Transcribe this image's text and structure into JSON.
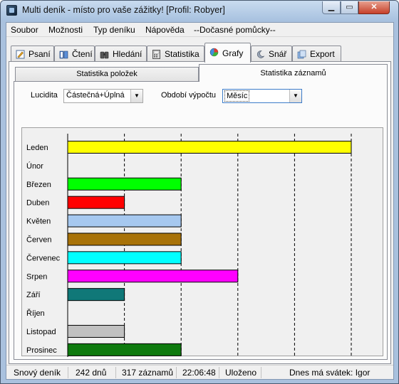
{
  "window": {
    "title": "Multi deník - místo pro vaše zážitky! [Profil: Robyer]"
  },
  "menu": [
    "Soubor",
    "Možnosti",
    "Typ deníku",
    "Nápověda",
    "--Dočasné pomůcky--"
  ],
  "tabs": [
    {
      "label": "Psaní",
      "icon": "pencil-icon"
    },
    {
      "label": "Čtení",
      "icon": "book-icon"
    },
    {
      "label": "Hledání",
      "icon": "binoculars-icon"
    },
    {
      "label": "Statistika",
      "icon": "calculator-icon"
    },
    {
      "label": "Grafy",
      "icon": "pie-chart-icon",
      "active": true
    },
    {
      "label": "Snář",
      "icon": "moon-icon"
    },
    {
      "label": "Export",
      "icon": "export-icon"
    }
  ],
  "subtabs": [
    "Statistika položek",
    "Statistika záznamů"
  ],
  "filters": {
    "lucidita_label": "Lucidita",
    "lucidita_value": "Částečná+Úplná",
    "period_label": "Období výpočtu",
    "period_value": "Měsíc"
  },
  "chart_data": {
    "type": "bar",
    "orientation": "horizontal",
    "categories": [
      "Leden",
      "Únor",
      "Březen",
      "Duben",
      "Květen",
      "Červen",
      "Červenec",
      "Srpen",
      "Září",
      "Říjen",
      "Listopad",
      "Prosinec"
    ],
    "values": [
      5,
      0,
      2,
      1,
      2,
      2,
      2,
      3,
      1,
      0,
      1,
      2
    ],
    "colors": [
      "#ffff00",
      "#ffffff",
      "#00ff00",
      "#ff0000",
      "#a6c8ef",
      "#a87208",
      "#00ffff",
      "#ff00ff",
      "#107878",
      "#ffffff",
      "#c0c0c0",
      "#0e7a0e"
    ],
    "xlim": [
      0,
      5
    ],
    "xticks": [
      0,
      1,
      2,
      3,
      4,
      5
    ],
    "grid": "vertical dashed"
  },
  "status": {
    "section": "Snový deník",
    "days": "242 dnů",
    "records": "317 záznamů",
    "time": "22:06:48",
    "state": "Uloženo",
    "nameday": "Dnes má svátek: Igor"
  }
}
